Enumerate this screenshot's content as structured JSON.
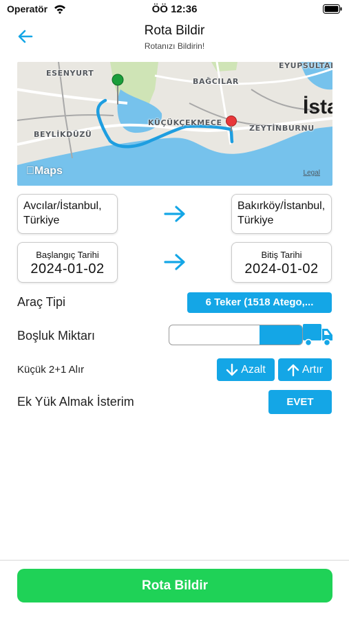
{
  "status_bar": {
    "carrier": "Operatör",
    "time": "ÖÖ 12:36"
  },
  "nav": {
    "title": "Rota Bildir",
    "subtitle": "Rotanızı Bildirin!"
  },
  "map": {
    "labels": {
      "esenyurt": "ESENYURT",
      "eyupsultan": "EYUPSULTAN",
      "bagcilar": "BAĞCILAR",
      "beylikduzu": "BEYLİKDÜZÜ",
      "kucukcekmece": "KÜÇÜKÇEKMECE",
      "zeytinburnu": "ZEYTİNBURNU",
      "istanbul_partial": "İsta"
    },
    "brand": "Maps",
    "legal": "Legal"
  },
  "route": {
    "origin": "Avcılar/İstanbul, Türkiye",
    "destination": "Bakırköy/İstanbul, Türkiye"
  },
  "dates": {
    "start_label": "Başlangıç Tarihi",
    "start_value": "2024-01-02",
    "end_label": "Bitiş Tarihi",
    "end_value": "2024-01-02"
  },
  "vehicle": {
    "label": "Araç Tipi",
    "value": "6 Teker (1518 Atego,..."
  },
  "space": {
    "label": "Boşluk Miktarı",
    "fill_fraction": 0.32
  },
  "small": {
    "label": "Küçük 2+1 Alır",
    "decrease": "Azalt",
    "increase": "Artır"
  },
  "extra": {
    "label": "Ek Yük Almak İsterim",
    "value": "EVET"
  },
  "submit": {
    "label": "Rota Bildir"
  },
  "colors": {
    "accent": "#14a6e6",
    "primary_button": "#1fd257"
  }
}
